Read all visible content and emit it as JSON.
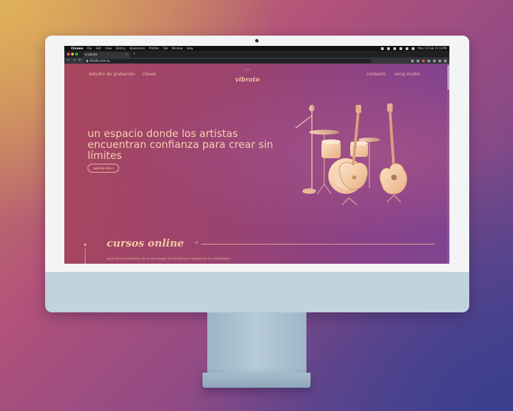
{
  "menubar": {
    "app_name": "Chrome",
    "items": [
      "File",
      "Edit",
      "View",
      "History",
      "Bookmarks",
      "Profiles",
      "Tab",
      "Window",
      "Help"
    ],
    "clock": "Mon 13 Feb  11:11PM"
  },
  "browser": {
    "tab_title": "vibrato",
    "new_tab": "+",
    "url": "vibrato.com.uy",
    "back": "←",
    "forward": "→",
    "reload": "↻"
  },
  "site": {
    "nav": {
      "studio": "estudio de grabación",
      "classes": "clases",
      "contact": "contacto",
      "song_studio": "song studio"
    },
    "logo": {
      "small": "((((",
      "name": "vibrato"
    },
    "hero": {
      "title": "un espacio donde los artistas encuentran confianza para crear sin límites",
      "cta": "agendá online"
    },
    "section": {
      "title": "cursos online",
      "subtitle": "aprendé herramientas de la tecnología del sonido para potenciar tu creatividad"
    }
  },
  "colors": {
    "accent": "#f3c7a4",
    "site_bg_start": "#a8465e",
    "site_bg_end": "#7e4391",
    "imac_silver": "#c0d3df"
  }
}
